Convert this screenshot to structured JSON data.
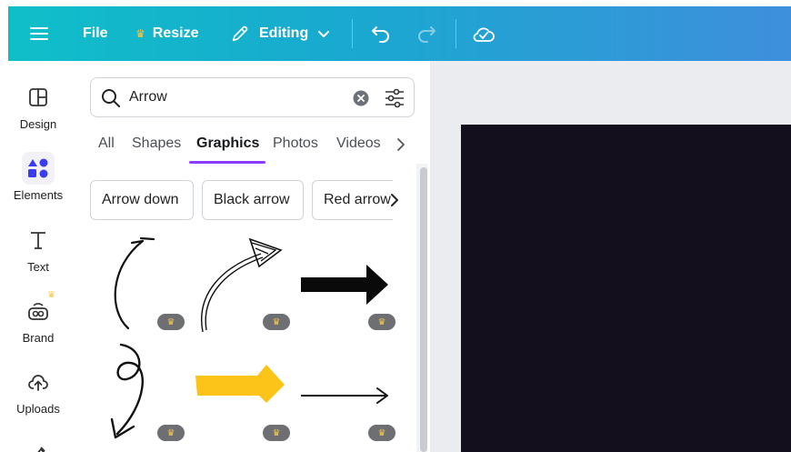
{
  "topbar": {
    "file_label": "File",
    "resize_label": "Resize",
    "editing_label": "Editing",
    "icons": [
      "menu-icon",
      "crown-icon",
      "pencil-icon",
      "chevron-down-icon",
      "undo-icon",
      "redo-icon",
      "cloud-check-icon"
    ]
  },
  "sidebar": {
    "items": [
      {
        "label": "Design",
        "icon": "layout-icon"
      },
      {
        "label": "Elements",
        "icon": "shapes-icon"
      },
      {
        "label": "Text",
        "icon": "text-icon"
      },
      {
        "label": "Brand",
        "icon": "brand-icon"
      },
      {
        "label": "Uploads",
        "icon": "upload-cloud-icon"
      }
    ]
  },
  "search": {
    "value": "Arrow"
  },
  "tabs": [
    {
      "label": "All"
    },
    {
      "label": "Shapes"
    },
    {
      "label": "Graphics"
    },
    {
      "label": "Photos"
    },
    {
      "label": "Videos"
    }
  ],
  "active_tab": "Graphics",
  "chips": [
    {
      "label": "Arrow down"
    },
    {
      "label": "Black arrow"
    },
    {
      "label": "Red arrow"
    }
  ],
  "colors": {
    "accent": "#8b3dff",
    "topbar_start": "#0fbfc8",
    "topbar_end": "#3e8fdc",
    "crown": "#f7c748",
    "yellow_arrow": "#fcc419",
    "artboard": "#130f1c"
  }
}
